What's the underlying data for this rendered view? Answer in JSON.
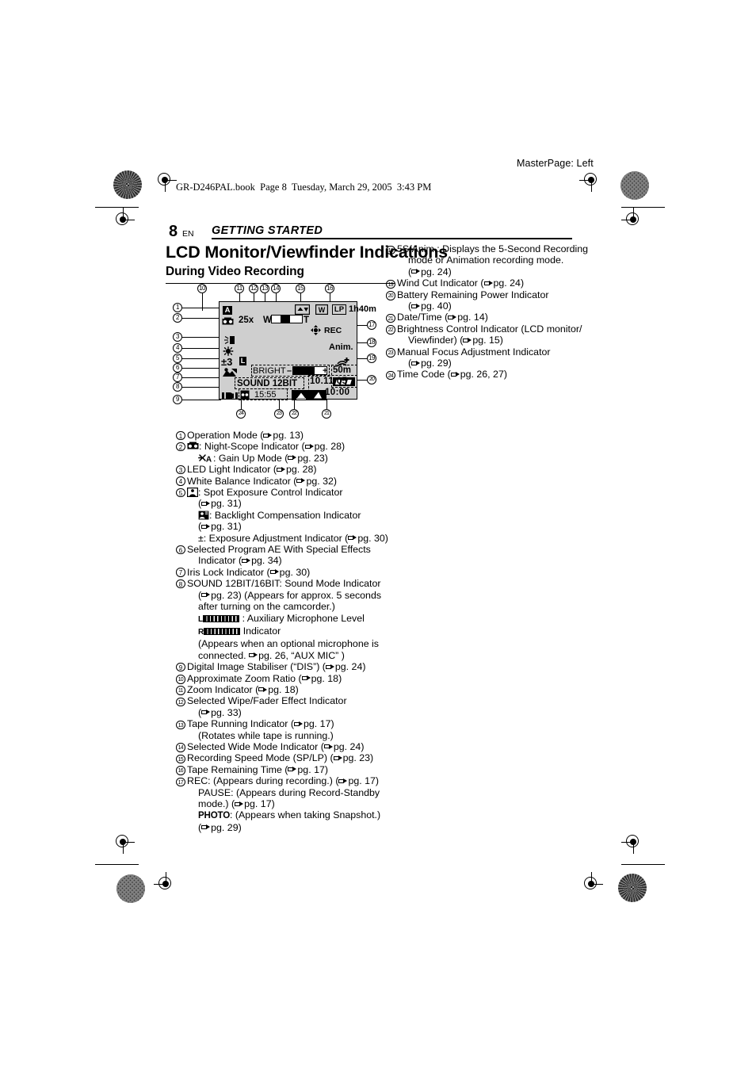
{
  "print_header": {
    "masterpage": "MasterPage: Left",
    "book_line": "GR-D246PAL.book  Page 8  Tuesday, March 29, 2005  3:43 PM"
  },
  "running_head": {
    "page_number": "8",
    "language": "EN",
    "section": "GETTING STARTED"
  },
  "headings": {
    "title": "LCD Monitor/Viewfinder Indications",
    "subtitle": "During Video Recording"
  },
  "figure": {
    "caption_ids_top": [
      "10",
      "11",
      "12",
      "13",
      "14",
      "15",
      "16"
    ],
    "caption_ids_left": [
      "1",
      "2",
      "3",
      "4",
      "5",
      "6",
      "7",
      "8",
      "9"
    ],
    "caption_ids_right": [
      "17",
      "18",
      "19",
      "20"
    ],
    "caption_ids_bottom": [
      "24",
      "23",
      "22",
      "21"
    ],
    "osd": {
      "operation_mode": "A",
      "night_scope": "night-scope-icon",
      "led_light": "led-light-icon",
      "white_balance": "white-balance-icon",
      "exposure_adjust": "±3",
      "iris_lock": "L",
      "program_ae": "program-ae-icon",
      "zoom_ratio": "25x",
      "zoom_wide_label": "W",
      "zoom_tele_label": "T",
      "wipe_fader": "wipe-fader-icon",
      "tape_running": "tape-running-icon",
      "wide_mode": "W",
      "recording_speed": "LP",
      "tape_remaining": "1h40m",
      "rec_status": "REC",
      "anim_mode": "Anim.",
      "wind_cut": "wind-cut-icon",
      "bright_label": "BRIGHT",
      "bright_minus": "–",
      "bright_plus": "+",
      "focus_distance": "50m",
      "sound_mode": "SOUND 12BIT",
      "dis_indicator": "dis-icon",
      "time_code": "15:55",
      "date": "10.11.05",
      "time": "10:00"
    }
  },
  "left_column": [
    {
      "num": "1",
      "lines": [
        {
          "text": "Operation Mode (",
          "ptr": true,
          "tail": "pg. 13)"
        }
      ]
    },
    {
      "num": "2",
      "lines": [
        {
          "icon": "night-scope-icon",
          "text": ": Night-Scope Indicator (",
          "ptr": true,
          "tail": "pg. 28)"
        },
        {
          "indent": true,
          "icon": "gain-up-icon",
          "text": ": Gain Up Mode (",
          "ptr": true,
          "tail": "pg. 23)"
        }
      ]
    },
    {
      "num": "3",
      "lines": [
        {
          "text": "LED Light Indicator (",
          "ptr": true,
          "tail": "pg. 28)"
        }
      ]
    },
    {
      "num": "4",
      "lines": [
        {
          "text": "White Balance Indicator (",
          "ptr": true,
          "tail": "pg. 32)"
        }
      ]
    },
    {
      "num": "5",
      "lines": [
        {
          "icon": "spot-exposure-icon",
          "text": ": Spot Exposure Control Indicator"
        },
        {
          "indent": true,
          "text": "(",
          "ptr": true,
          "tail": "pg. 31)"
        },
        {
          "indent": true,
          "icon": "backlight-icon",
          "text": ": Backlight Compensation Indicator"
        },
        {
          "indent": true,
          "text": "(",
          "ptr": true,
          "tail": "pg. 31)"
        },
        {
          "indent": true,
          "text": "±: Exposure Adjustment Indicator (",
          "ptr": true,
          "tail": "pg. 30)"
        }
      ]
    },
    {
      "num": "6",
      "lines": [
        {
          "text": "Selected Program AE With Special Effects"
        },
        {
          "indent": true,
          "text": "Indicator (",
          "ptr": true,
          "tail": "pg. 34)"
        }
      ]
    },
    {
      "num": "7",
      "lines": [
        {
          "text": "Iris Lock Indicator (",
          "ptr": true,
          "tail": "pg. 30)"
        }
      ]
    },
    {
      "num": "8",
      "lines": [
        {
          "text": "SOUND 12BIT/16BIT: Sound Mode Indicator"
        },
        {
          "indent": true,
          "text": "(",
          "ptr": true,
          "tail": "pg. 23) (Appears for approx. 5 seconds"
        },
        {
          "indent": true,
          "text": "after turning on the camcorder.)"
        },
        {
          "indent": true,
          "meter": "L",
          "text": ": Auxiliary Microphone Level"
        },
        {
          "indent": true,
          "meter": "R",
          "text": "Indicator"
        },
        {
          "indent": true,
          "text": "(Appears when an optional microphone is"
        },
        {
          "indent": true,
          "text": "connected. ",
          "ptr": true,
          "tail": "pg. 26, “AUX MIC” )"
        }
      ]
    },
    {
      "num": "9",
      "lines": [
        {
          "text": "Digital Image Stabiliser (“DIS”) (",
          "ptr": true,
          "tail": "pg. 24)"
        }
      ]
    },
    {
      "num": "10",
      "lines": [
        {
          "text": "Approximate Zoom Ratio (",
          "ptr": true,
          "tail": "pg. 18)"
        }
      ]
    },
    {
      "num": "11",
      "lines": [
        {
          "text": "Zoom Indicator (",
          "ptr": true,
          "tail": "pg. 18)"
        }
      ]
    },
    {
      "num": "12",
      "lines": [
        {
          "text": "Selected Wipe/Fader Effect Indicator"
        },
        {
          "indent": true,
          "text": "(",
          "ptr": true,
          "tail": "pg. 33)"
        }
      ]
    },
    {
      "num": "13",
      "lines": [
        {
          "text": "Tape Running Indicator (",
          "ptr": true,
          "tail": "pg. 17)"
        },
        {
          "indent": true,
          "text": "(Rotates while tape is running.)"
        }
      ]
    },
    {
      "num": "14",
      "lines": [
        {
          "text": "Selected Wide Mode Indicator (",
          "ptr": true,
          "tail": "pg. 24)"
        }
      ]
    },
    {
      "num": "15",
      "lines": [
        {
          "text": "Recording Speed Mode (SP/LP) (",
          "ptr": true,
          "tail": "pg. 23)"
        }
      ]
    },
    {
      "num": "16",
      "lines": [
        {
          "text": "Tape Remaining Time (",
          "ptr": true,
          "tail": "pg. 17)"
        }
      ]
    },
    {
      "num": "17",
      "lines": [
        {
          "text": "REC: (Appears during recording.) (",
          "ptr": true,
          "tail": "pg. 17)"
        },
        {
          "indent": true,
          "text": "PAUSE: (Appears during Record-Standby"
        },
        {
          "indent": true,
          "text": "mode.) (",
          "ptr": true,
          "tail": "pg. 17)"
        },
        {
          "indent": true,
          "photo": "PHOTO",
          "text": ": (Appears when taking Snapshot.)"
        },
        {
          "indent": true,
          "text": "(",
          "ptr": true,
          "tail": "pg. 29)"
        }
      ]
    }
  ],
  "right_column": [
    {
      "num": "18",
      "lines": [
        {
          "text": "5S/Anim.: Displays the 5-Second Recording"
        },
        {
          "indent": true,
          "text": "mode or Animation recording mode."
        },
        {
          "indent": true,
          "text": "(",
          "ptr": true,
          "tail": "pg. 24)"
        }
      ]
    },
    {
      "num": "19",
      "lines": [
        {
          "text": "Wind Cut Indicator (",
          "ptr": true,
          "tail": "pg. 24)"
        }
      ]
    },
    {
      "num": "20",
      "lines": [
        {
          "text": "Battery Remaining Power Indicator"
        },
        {
          "indent": true,
          "text": "(",
          "ptr": true,
          "tail": "pg. 40)"
        }
      ]
    },
    {
      "num": "21",
      "lines": [
        {
          "text": "Date/Time (",
          "ptr": true,
          "tail": "pg. 14)"
        }
      ]
    },
    {
      "num": "22",
      "lines": [
        {
          "text": "Brightness Control Indicator (LCD monitor/"
        },
        {
          "indent": true,
          "text": "Viewfinder) (",
          "ptr": true,
          "tail": "pg. 15)"
        }
      ]
    },
    {
      "num": "23",
      "lines": [
        {
          "text": "Manual Focus Adjustment Indicator"
        },
        {
          "indent": true,
          "text": "(",
          "ptr": true,
          "tail": "pg. 29)"
        }
      ]
    },
    {
      "num": "24",
      "lines": [
        {
          "text": "Time Code (",
          "ptr": true,
          "tail": "pg. 26, 27)"
        }
      ]
    }
  ]
}
